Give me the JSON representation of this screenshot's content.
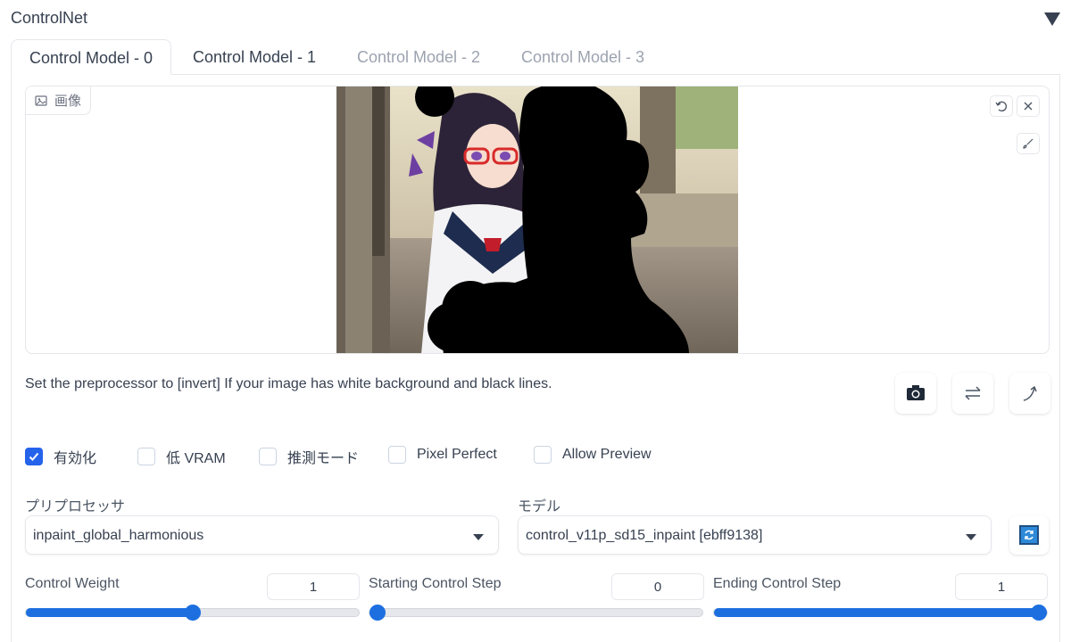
{
  "panel": {
    "title": "ControlNet"
  },
  "tabs": [
    {
      "label": "Control Model - 0",
      "active": true
    },
    {
      "label": "Control Model - 1",
      "active": false
    },
    {
      "label": "Control Model - 2",
      "active": false
    },
    {
      "label": "Control Model - 3",
      "active": false
    }
  ],
  "image_panel": {
    "label": "画像",
    "icons": [
      "image-icon",
      "undo-icon",
      "close-icon",
      "brush-icon"
    ]
  },
  "hint": "Set the preprocessor to [invert] If your image has white background and black lines.",
  "tools": [
    "camera-icon",
    "swap-icon",
    "send-arrow-icon"
  ],
  "checkboxes": [
    {
      "label": "有効化",
      "checked": true
    },
    {
      "label": "低 VRAM",
      "checked": false
    },
    {
      "label": "推測モード",
      "checked": false
    },
    {
      "label": "Pixel Perfect",
      "checked": false
    },
    {
      "label": "Allow Preview",
      "checked": false
    }
  ],
  "preprocessor": {
    "label": "プリプロセッサ",
    "value": "inpaint_global_harmonious"
  },
  "model": {
    "label": "モデル",
    "value": "control_v11p_sd15_inpaint [ebff9138]"
  },
  "sliders": [
    {
      "label": "Control Weight",
      "value": "1",
      "fraction": 0.5
    },
    {
      "label": "Starting Control Step",
      "value": "0",
      "fraction": 0.0
    },
    {
      "label": "Ending Control Step",
      "value": "1",
      "fraction": 1.0
    }
  ],
  "colors": {
    "accent": "#2563eb",
    "slider": "#1d6fe0",
    "border": "#e5e7eb"
  }
}
